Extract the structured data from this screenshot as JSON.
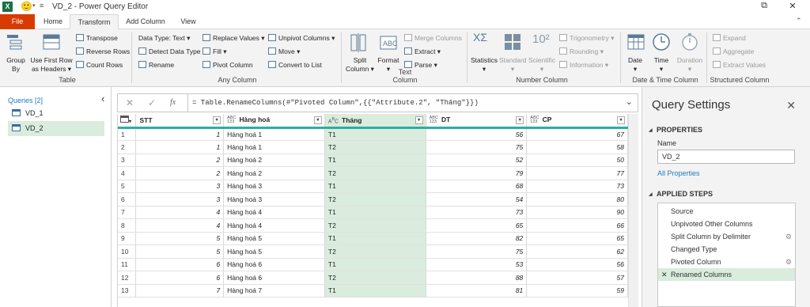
{
  "titlebar": {
    "title": "VD_2 - Power Query Editor",
    "app_icon": "excel-icon",
    "restore": "⧉",
    "close": "✕"
  },
  "tabs": [
    "File",
    "Home",
    "Transform",
    "Add Column",
    "View"
  ],
  "active_tab": "Transform",
  "ribbon": {
    "table": {
      "group_by": "Group\nBy",
      "use_first_row": "Use First Row\nas Headers ▾",
      "transpose": "Transpose",
      "reverse_rows": "Reverse Rows",
      "count_rows": "Count Rows",
      "label": "Table"
    },
    "any_column": {
      "data_type": "Data Type: Text ▾",
      "detect_data_type": "Detect Data Type",
      "rename": "Rename",
      "replace_values": "Replace Values ▾",
      "fill": "Fill ▾",
      "pivot_column": "Pivot Column",
      "unpivot_columns": "Unpivot Columns ▾",
      "move": "Move ▾",
      "convert_to_list": "Convert to List",
      "label": "Any Column"
    },
    "text_column": {
      "split_column": "Split\nColumn ▾",
      "format": "Format\n▾",
      "merge_columns": "Merge Columns",
      "extract": "Extract ▾",
      "parse": "Parse ▾",
      "label": "Text Column"
    },
    "number_column": {
      "statistics": "Statistics\n▾",
      "standard": "Standard\n▾",
      "scientific": "Scientific\n▾",
      "trigonometry": "Trigonometry ▾",
      "rounding": "Rounding ▾",
      "information": "Information ▾",
      "label": "Number Column"
    },
    "datetime_column": {
      "date": "Date\n▾",
      "time": "Time\n▾",
      "duration": "Duration\n▾",
      "label": "Date & Time Column"
    },
    "structured_column": {
      "expand": "Expand",
      "aggregate": "Aggregate",
      "extract_values": "Extract Values",
      "label": "Structured Column"
    }
  },
  "queries": {
    "header": "Queries [2]",
    "items": [
      "VD_1",
      "VD_2"
    ],
    "selected": "VD_2"
  },
  "formula_bar": {
    "cancel": "✕",
    "confirm": "✓",
    "fx": "fx",
    "formula": "= Table.RenameColumns(#\"Pivoted Column\",{{\"Attribute.2\", \"Tháng\"}})"
  },
  "grid": {
    "columns": [
      {
        "name": "STT",
        "type": "",
        "selected": false
      },
      {
        "name": "Hàng hoá",
        "type": "ABC\n123",
        "selected": false
      },
      {
        "name": "Tháng",
        "type": "A͡B",
        "selected": true
      },
      {
        "name": "DT",
        "type": "ABC\n123",
        "selected": false
      },
      {
        "name": "CP",
        "type": "ABC\n123",
        "selected": false
      }
    ],
    "rows": [
      [
        "1",
        "1",
        "Hàng hoá 1",
        "T1",
        "56",
        "67"
      ],
      [
        "2",
        "1",
        "Hàng hoá 1",
        "T2",
        "75",
        "58"
      ],
      [
        "3",
        "2",
        "Hàng hoá 2",
        "T1",
        "52",
        "50"
      ],
      [
        "4",
        "2",
        "Hàng hoá 2",
        "T2",
        "79",
        "77"
      ],
      [
        "5",
        "3",
        "Hàng hoá 3",
        "T1",
        "68",
        "73"
      ],
      [
        "6",
        "3",
        "Hàng hoá 3",
        "T2",
        "54",
        "80"
      ],
      [
        "7",
        "4",
        "Hàng hoá 4",
        "T1",
        "73",
        "90"
      ],
      [
        "8",
        "4",
        "Hàng hoá 4",
        "T2",
        "65",
        "66"
      ],
      [
        "9",
        "5",
        "Hàng hoá 5",
        "T1",
        "82",
        "65"
      ],
      [
        "10",
        "5",
        "Hàng hoá 5",
        "T2",
        "75",
        "62"
      ],
      [
        "11",
        "6",
        "Hàng hoá 6",
        "T1",
        "53",
        "56"
      ],
      [
        "12",
        "6",
        "Hàng hoá 6",
        "T2",
        "88",
        "57"
      ],
      [
        "13",
        "7",
        "Hàng hoá 7",
        "T1",
        "81",
        "59"
      ]
    ]
  },
  "settings": {
    "title": "Query Settings",
    "properties": "PROPERTIES",
    "name_label": "Name",
    "name_value": "VD_2",
    "all_properties": "All Properties",
    "applied_steps": "APPLIED STEPS",
    "steps": [
      {
        "label": "Source",
        "gear": false
      },
      {
        "label": "Unpivoted Other Columns",
        "gear": false
      },
      {
        "label": "Split Column by Delimiter",
        "gear": true
      },
      {
        "label": "Changed Type",
        "gear": false
      },
      {
        "label": "Pivoted Column",
        "gear": true
      },
      {
        "label": "Renamed Columns",
        "gear": false
      }
    ],
    "active_step": "Renamed Columns"
  },
  "colors": {
    "file_tab": "#d83b01",
    "selected_bg": "#d9ecdd",
    "header_underline": "#2dada0",
    "link": "#217bbf"
  }
}
